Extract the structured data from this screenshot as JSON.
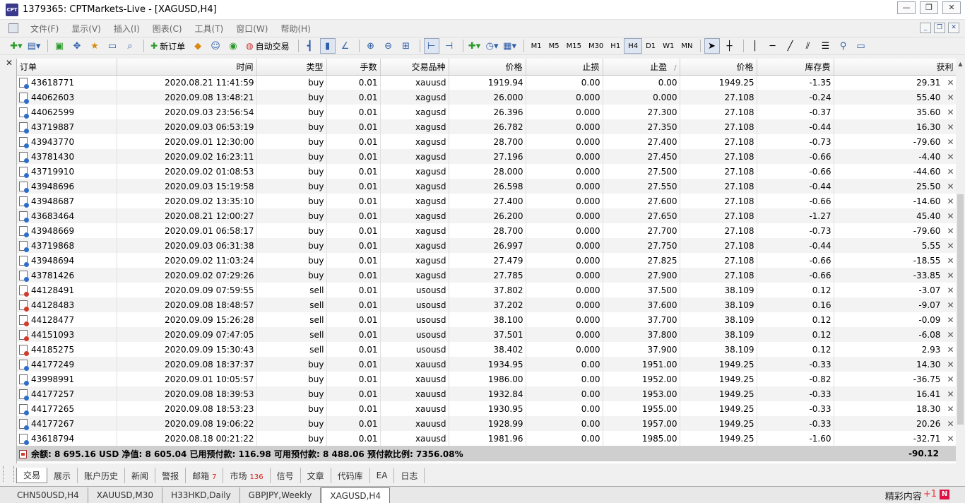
{
  "window": {
    "title": "1379365: CPTMarkets-Live - [XAGUSD,H4]",
    "app_badge": "CPT",
    "minimize": "—",
    "restore": "❐",
    "close": "✕"
  },
  "menu": [
    "文件(F)",
    "显示(V)",
    "插入(I)",
    "图表(C)",
    "工具(T)",
    "窗口(W)",
    "帮助(H)"
  ],
  "mdi": {
    "minimize": "_",
    "restore": "❐",
    "close": "✕"
  },
  "toolbar": {
    "new_order": "新订单",
    "auto_trading": "自动交易",
    "timeframes": [
      "M1",
      "M5",
      "M15",
      "M30",
      "H1",
      "H4",
      "D1",
      "W1",
      "MN"
    ],
    "active_timeframe": "H4"
  },
  "table": {
    "headers": [
      "订单",
      "时间",
      "类型",
      "手数",
      "交易品种",
      "价格",
      "止损",
      "止盈",
      "价格",
      "库存费",
      "获利"
    ],
    "sort_mark": "/",
    "rows": [
      [
        "43618771",
        "2020.08.21 11:41:59",
        "buy",
        "0.01",
        "xauusd",
        "1919.94",
        "0.00",
        "0.00",
        "1949.25",
        "-1.35",
        "29.31"
      ],
      [
        "44062603",
        "2020.09.08 13:48:21",
        "buy",
        "0.01",
        "xagusd",
        "26.000",
        "0.000",
        "0.000",
        "27.108",
        "-0.24",
        "55.40"
      ],
      [
        "44062599",
        "2020.09.03 23:56:54",
        "buy",
        "0.01",
        "xagusd",
        "26.396",
        "0.000",
        "27.300",
        "27.108",
        "-0.37",
        "35.60"
      ],
      [
        "43719887",
        "2020.09.03 06:53:19",
        "buy",
        "0.01",
        "xagusd",
        "26.782",
        "0.000",
        "27.350",
        "27.108",
        "-0.44",
        "16.30"
      ],
      [
        "43943770",
        "2020.09.01 12:30:00",
        "buy",
        "0.01",
        "xagusd",
        "28.700",
        "0.000",
        "27.400",
        "27.108",
        "-0.73",
        "-79.60"
      ],
      [
        "43781430",
        "2020.09.02 16:23:11",
        "buy",
        "0.01",
        "xagusd",
        "27.196",
        "0.000",
        "27.450",
        "27.108",
        "-0.66",
        "-4.40"
      ],
      [
        "43719910",
        "2020.09.02 01:08:53",
        "buy",
        "0.01",
        "xagusd",
        "28.000",
        "0.000",
        "27.500",
        "27.108",
        "-0.66",
        "-44.60"
      ],
      [
        "43948696",
        "2020.09.03 15:19:58",
        "buy",
        "0.01",
        "xagusd",
        "26.598",
        "0.000",
        "27.550",
        "27.108",
        "-0.44",
        "25.50"
      ],
      [
        "43948687",
        "2020.09.02 13:35:10",
        "buy",
        "0.01",
        "xagusd",
        "27.400",
        "0.000",
        "27.600",
        "27.108",
        "-0.66",
        "-14.60"
      ],
      [
        "43683464",
        "2020.08.21 12:00:27",
        "buy",
        "0.01",
        "xagusd",
        "26.200",
        "0.000",
        "27.650",
        "27.108",
        "-1.27",
        "45.40"
      ],
      [
        "43948669",
        "2020.09.01 06:58:17",
        "buy",
        "0.01",
        "xagusd",
        "28.700",
        "0.000",
        "27.700",
        "27.108",
        "-0.73",
        "-79.60"
      ],
      [
        "43719868",
        "2020.09.03 06:31:38",
        "buy",
        "0.01",
        "xagusd",
        "26.997",
        "0.000",
        "27.750",
        "27.108",
        "-0.44",
        "5.55"
      ],
      [
        "43948694",
        "2020.09.02 11:03:24",
        "buy",
        "0.01",
        "xagusd",
        "27.479",
        "0.000",
        "27.825",
        "27.108",
        "-0.66",
        "-18.55"
      ],
      [
        "43781426",
        "2020.09.02 07:29:26",
        "buy",
        "0.01",
        "xagusd",
        "27.785",
        "0.000",
        "27.900",
        "27.108",
        "-0.66",
        "-33.85"
      ],
      [
        "44128491",
        "2020.09.09 07:59:55",
        "sell",
        "0.01",
        "usousd",
        "37.802",
        "0.000",
        "37.500",
        "38.109",
        "0.12",
        "-3.07"
      ],
      [
        "44128483",
        "2020.09.08 18:48:57",
        "sell",
        "0.01",
        "usousd",
        "37.202",
        "0.000",
        "37.600",
        "38.109",
        "0.16",
        "-9.07"
      ],
      [
        "44128477",
        "2020.09.09 15:26:28",
        "sell",
        "0.01",
        "usousd",
        "38.100",
        "0.000",
        "37.700",
        "38.109",
        "0.12",
        "-0.09"
      ],
      [
        "44151093",
        "2020.09.09 07:47:05",
        "sell",
        "0.01",
        "usousd",
        "37.501",
        "0.000",
        "37.800",
        "38.109",
        "0.12",
        "-6.08"
      ],
      [
        "44185275",
        "2020.09.09 15:30:43",
        "sell",
        "0.01",
        "usousd",
        "38.402",
        "0.000",
        "37.900",
        "38.109",
        "0.12",
        "2.93"
      ],
      [
        "44177249",
        "2020.09.08 18:37:37",
        "buy",
        "0.01",
        "xauusd",
        "1934.95",
        "0.00",
        "1951.00",
        "1949.25",
        "-0.33",
        "14.30"
      ],
      [
        "43998991",
        "2020.09.01 10:05:57",
        "buy",
        "0.01",
        "xauusd",
        "1986.00",
        "0.00",
        "1952.00",
        "1949.25",
        "-0.82",
        "-36.75"
      ],
      [
        "44177257",
        "2020.09.08 18:39:53",
        "buy",
        "0.01",
        "xauusd",
        "1932.84",
        "0.00",
        "1953.00",
        "1949.25",
        "-0.33",
        "16.41"
      ],
      [
        "44177265",
        "2020.09.08 18:53:23",
        "buy",
        "0.01",
        "xauusd",
        "1930.95",
        "0.00",
        "1955.00",
        "1949.25",
        "-0.33",
        "18.30"
      ],
      [
        "44177267",
        "2020.09.08 19:06:22",
        "buy",
        "0.01",
        "xauusd",
        "1928.99",
        "0.00",
        "1957.00",
        "1949.25",
        "-0.33",
        "20.26"
      ],
      [
        "43618794",
        "2020.08.18 00:21:22",
        "buy",
        "0.01",
        "xauusd",
        "1981.96",
        "0.00",
        "1985.00",
        "1949.25",
        "-1.60",
        "-32.71"
      ]
    ],
    "summary": {
      "text": "余额: 8 695.16 USD  净值: 8 605.04  已用预付款: 116.98  可用预付款: 8 488.06  预付款比例: 7356.08%",
      "total_profit": "-90.12"
    }
  },
  "terminal_tabs": [
    {
      "label": "交易",
      "badge": ""
    },
    {
      "label": "展示",
      "badge": ""
    },
    {
      "label": "账户历史",
      "badge": ""
    },
    {
      "label": "新闻",
      "badge": ""
    },
    {
      "label": "警报",
      "badge": ""
    },
    {
      "label": "邮箱",
      "badge": "7"
    },
    {
      "label": "市场",
      "badge": "136"
    },
    {
      "label": "信号",
      "badge": ""
    },
    {
      "label": "文章",
      "badge": ""
    },
    {
      "label": "代码库",
      "badge": ""
    },
    {
      "label": "EA",
      "badge": ""
    },
    {
      "label": "日志",
      "badge": ""
    }
  ],
  "chart_tabs": [
    "CHN50USD,H4",
    "XAUUSD,M30",
    "H33HKD,Daily",
    "GBPJPY,Weekly",
    "XAGUSD,H4"
  ],
  "active_chart_tab": "XAGUSD,H4",
  "promo": {
    "label": "精彩内容",
    "plus": "+1",
    "badge": "N"
  }
}
